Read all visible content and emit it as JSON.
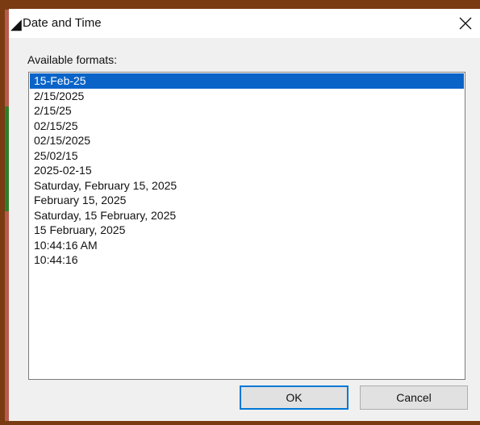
{
  "dialog": {
    "title": "Date and Time",
    "close_icon": "close-icon"
  },
  "formats": {
    "label": "Available formats:",
    "items": [
      {
        "label": "15-Feb-25",
        "selected": true
      },
      {
        "label": "2/15/2025",
        "selected": false
      },
      {
        "label": "2/15/25",
        "selected": false
      },
      {
        "label": "02/15/25",
        "selected": false
      },
      {
        "label": "02/15/2025",
        "selected": false
      },
      {
        "label": "25/02/15",
        "selected": false
      },
      {
        "label": "2025-02-15",
        "selected": false
      },
      {
        "label": "Saturday, February 15, 2025",
        "selected": false
      },
      {
        "label": "February 15, 2025",
        "selected": false
      },
      {
        "label": "Saturday, 15 February, 2025",
        "selected": false
      },
      {
        "label": "15 February, 2025",
        "selected": false
      },
      {
        "label": "10:44:16 AM",
        "selected": false
      },
      {
        "label": "10:44:16",
        "selected": false
      }
    ]
  },
  "buttons": {
    "ok_label": "OK",
    "cancel_label": "Cancel"
  },
  "colors": {
    "selection": "#0a64c8",
    "frame": "#7a3b12",
    "default_button_border": "#0078d7"
  }
}
